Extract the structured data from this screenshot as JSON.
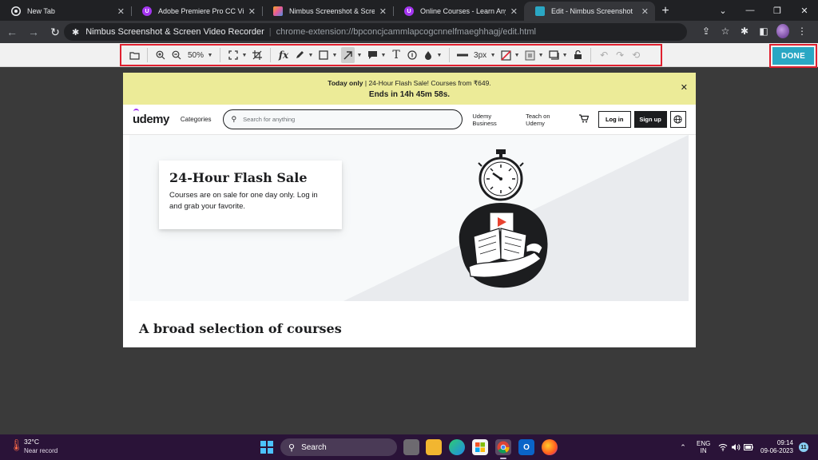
{
  "browser": {
    "tabs": [
      {
        "title": "New Tab",
        "icon": "chrome-icon",
        "color": "#e8eaed",
        "active": false
      },
      {
        "title": "Adobe Premiere Pro CC Video E",
        "icon": "udemy-icon",
        "color": "#a435f0",
        "active": false
      },
      {
        "title": "Nimbus Screenshot & Screen Vi",
        "icon": "nimbus-icon",
        "color": "#f5a623",
        "active": false
      },
      {
        "title": "Online Courses - Learn Anything",
        "icon": "udemy-icon",
        "color": "#a435f0",
        "active": false
      },
      {
        "title": "Edit - Nimbus Screenshot",
        "icon": "nimbus-icon",
        "color": "#2aa7c4",
        "active": true
      }
    ],
    "new_tab_glyph": "+",
    "close_glyph": "✕",
    "omnibox": {
      "extension_name": "Nimbus Screenshot & Screen Video Recorder",
      "separator": "|",
      "url": "chrome-extension://bpconcjcammlapcogcnnelfmaeghhagj/edit.html"
    }
  },
  "toolbar": {
    "zoom_label": "50%",
    "fx_label": "fx",
    "line_width_label": "3px",
    "done_label": "DONE",
    "done_color": "#2aa7c4",
    "highlight_color": "#e0202f"
  },
  "page": {
    "promo": {
      "bold": "Today only",
      "rest": " | 24-Hour Flash Sale! Courses from ₹649.",
      "countdown": "Ends in 14h 45m 58s.",
      "close": "✕"
    },
    "header": {
      "logo": "udemy",
      "categories": "Categories",
      "search_placeholder": "Search for anything",
      "business": "Udemy Business",
      "teach": "Teach on Udemy",
      "login": "Log in",
      "signup": "Sign up"
    },
    "hero": {
      "title": "24-Hour Flash Sale",
      "body": "Courses are on sale for one day only. Log in and grab your favorite."
    },
    "section_title": "A broad selection of courses"
  },
  "taskbar": {
    "temperature": "32°C",
    "weather_note": "Near record",
    "search_label": "Search",
    "lang_line1": "ENG",
    "lang_line2": "IN",
    "time": "09:14",
    "date": "09-06-2023",
    "notification_count": "11"
  }
}
